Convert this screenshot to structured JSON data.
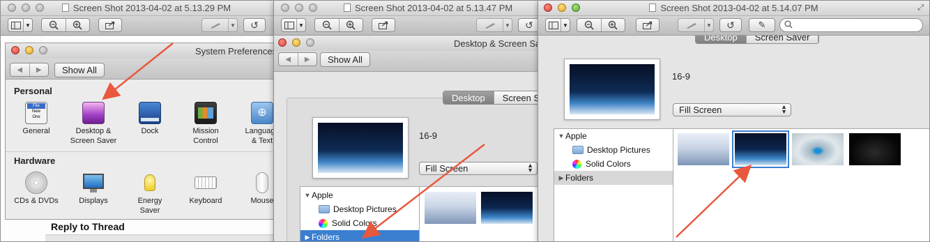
{
  "windows": [
    {
      "title": "Screen Shot 2013-04-02 at 5.13.29 PM",
      "prefs_title": "System Preferences",
      "show_all": "Show All",
      "personal_label": "Personal",
      "hardware_label": "Hardware",
      "personal_items": [
        {
          "label": "General",
          "icon": "general-icon"
        },
        {
          "label": "Desktop &\nScreen Saver",
          "icon": "desktop-screensaver-icon"
        },
        {
          "label": "Dock",
          "icon": "dock-icon"
        },
        {
          "label": "Mission\nControl",
          "icon": "mission-control-icon"
        },
        {
          "label": "Language\n& Text",
          "icon": "language-text-icon"
        }
      ],
      "hardware_items": [
        {
          "label": "CDs & DVDs",
          "icon": "cd-dvd-icon"
        },
        {
          "label": "Displays",
          "icon": "displays-icon"
        },
        {
          "label": "Energy\nSaver",
          "icon": "energy-saver-icon"
        },
        {
          "label": "Keyboard",
          "icon": "keyboard-icon"
        },
        {
          "label": "Mouse",
          "icon": "mouse-icon"
        }
      ],
      "general_icon_text": [
        "File",
        "New",
        "One"
      ],
      "background_text": "Reply to Thread"
    },
    {
      "title": "Screen Shot 2013-04-02 at 5.13.47 PM",
      "prefs_title": "Desktop & Screen Saver",
      "show_all": "Show All",
      "tab_desktop": "Desktop",
      "tab_screensaver": "Screen Saver",
      "wallpaper_name": "16-9",
      "fill_mode": "Fill Screen",
      "source_apple": "Apple",
      "source_desktop_pictures": "Desktop Pictures",
      "source_solid_colors": "Solid Colors",
      "source_folders": "Folders"
    },
    {
      "title": "Screen Shot 2013-04-02 at 5.14.07 PM",
      "tab_desktop": "Desktop",
      "tab_screensaver": "Screen Saver",
      "wallpaper_name": "16-9",
      "fill_mode": "Fill Screen",
      "source_apple": "Apple",
      "source_desktop_pictures": "Desktop Pictures",
      "source_solid_colors": "Solid Colors",
      "source_folders": "Folders"
    }
  ],
  "colors": {
    "annotation_arrow": "#e8583f",
    "selection_blue": "#3b7fd1",
    "folders_selected_bg": "#3b7fd1"
  }
}
